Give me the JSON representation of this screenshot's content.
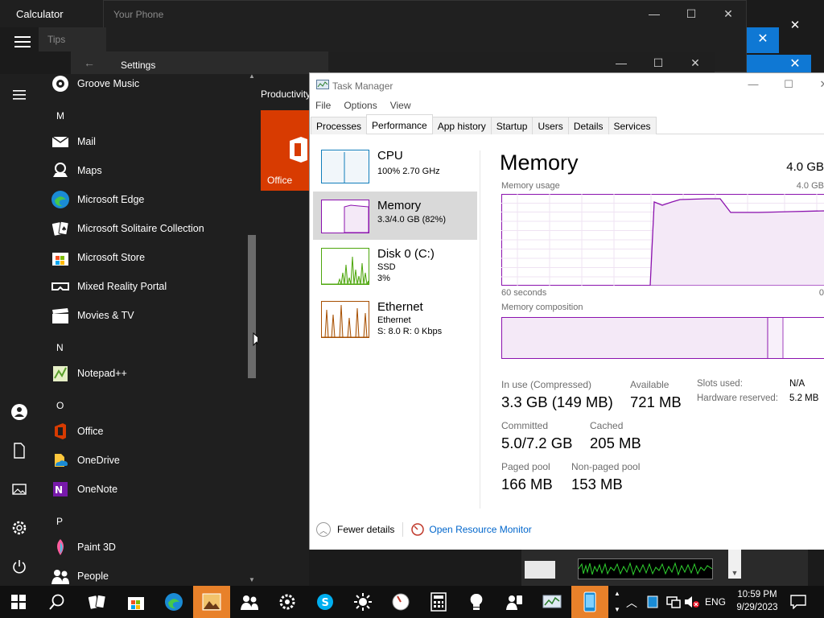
{
  "windows": {
    "calculator_title": "Calculator",
    "phone_title": "Your Phone",
    "tips_title": "Tips",
    "settings_title": "Settings"
  },
  "start_menu": {
    "apps": [
      {
        "letter": null,
        "label": "Groove Music",
        "icon": "groove-music-icon"
      },
      {
        "letter": "M",
        "label": null
      },
      {
        "letter": null,
        "label": "Mail",
        "icon": "mail-icon"
      },
      {
        "letter": null,
        "label": "Maps",
        "icon": "maps-icon"
      },
      {
        "letter": null,
        "label": "Microsoft Edge",
        "icon": "edge-icon"
      },
      {
        "letter": null,
        "label": "Microsoft Solitaire Collection",
        "icon": "solitaire-icon"
      },
      {
        "letter": null,
        "label": "Microsoft Store",
        "icon": "store-icon"
      },
      {
        "letter": null,
        "label": "Mixed Reality Portal",
        "icon": "mixed-reality-icon"
      },
      {
        "letter": null,
        "label": "Movies & TV",
        "icon": "movies-icon"
      },
      {
        "letter": "N",
        "label": null
      },
      {
        "letter": null,
        "label": "Notepad++",
        "icon": "notepadpp-icon"
      },
      {
        "letter": "O",
        "label": null
      },
      {
        "letter": null,
        "label": "Office",
        "icon": "office-icon"
      },
      {
        "letter": null,
        "label": "OneDrive",
        "icon": "onedrive-icon"
      },
      {
        "letter": null,
        "label": "OneNote",
        "icon": "onenote-icon"
      },
      {
        "letter": "P",
        "label": null
      },
      {
        "letter": null,
        "label": "Paint 3D",
        "icon": "paint3d-icon"
      },
      {
        "letter": null,
        "label": "People",
        "icon": "people-icon"
      }
    ],
    "group_title": "Productivity",
    "office_tile_label": "Office"
  },
  "task_manager": {
    "title": "Task Manager",
    "menu": [
      "File",
      "Options",
      "View"
    ],
    "tabs": [
      "Processes",
      "Performance",
      "App history",
      "Startup",
      "Users",
      "Details",
      "Services"
    ],
    "active_tab": "Performance",
    "sidebar": [
      {
        "name": "CPU",
        "line1": "100% 2.70 GHz",
        "line2": ""
      },
      {
        "name": "Memory",
        "line1": "3.3/4.0 GB (82%)",
        "line2": ""
      },
      {
        "name": "Disk 0 (C:)",
        "line1": "SSD",
        "line2": "3%"
      },
      {
        "name": "Ethernet",
        "line1": "Ethernet",
        "line2": "S: 8.0 R: 0 Kbps"
      }
    ],
    "pane": {
      "title": "Memory",
      "total": "4.0 GB",
      "usage_label": "Memory usage",
      "usage_max": "4.0 GB",
      "time_span": "60 seconds",
      "time_end": "0",
      "composition_label": "Memory composition",
      "in_use_label": "In use (Compressed)",
      "in_use_value": "3.3 GB (149 MB)",
      "available_label": "Available",
      "available_value": "721 MB",
      "committed_label": "Committed",
      "committed_value": "5.0/7.2 GB",
      "cached_label": "Cached",
      "cached_value": "205 MB",
      "paged_label": "Paged pool",
      "paged_value": "166 MB",
      "nonpaged_label": "Non-paged pool",
      "nonpaged_value": "153 MB",
      "slots_label": "Slots used:",
      "slots_value": "N/A",
      "hw_reserved_label": "Hardware reserved:",
      "hw_reserved_value": "5.2 MB"
    },
    "footer": {
      "fewer_details": "Fewer details",
      "resource_monitor": "Open Resource Monitor"
    }
  },
  "taskbar": {
    "tray_language": "ENG",
    "clock_time": "10:59 PM",
    "clock_date": "9/29/2023"
  },
  "colors": {
    "memory_accent": "#8b12ae",
    "cpu_accent": "#117dbb",
    "disk_accent": "#4da60c",
    "ethernet_accent": "#a74f01",
    "office_tile": "#d83b01",
    "windows_blue": "#0f78d4"
  }
}
